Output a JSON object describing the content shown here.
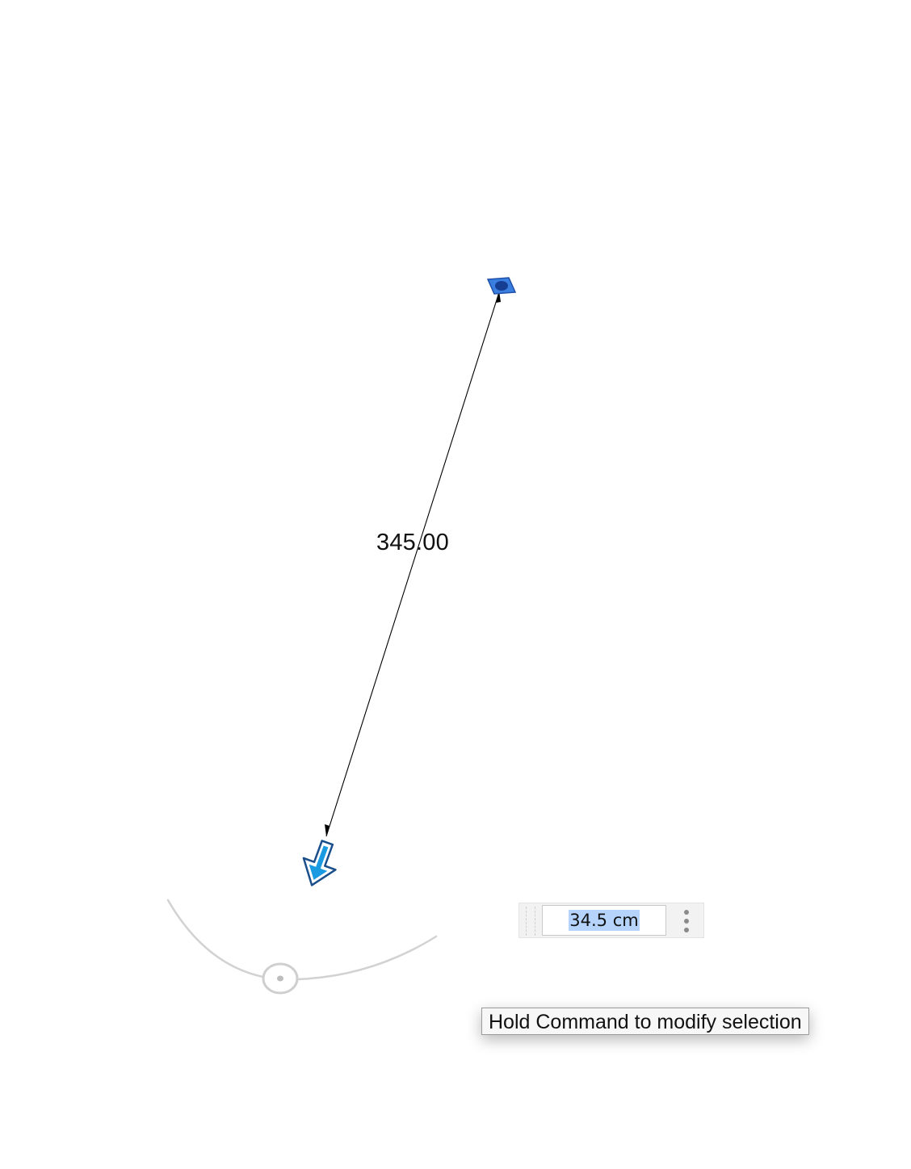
{
  "dimension": {
    "label": "345.00"
  },
  "dimension_input": {
    "value": "34.5 cm",
    "more_icon": "vertical-ellipsis-icon"
  },
  "tooltip": {
    "text": "Hold Command to modify selection"
  },
  "colors": {
    "start_grip": "#2f6fd0",
    "end_arrow": "#1a96dc",
    "selection_highlight": "#b6d4fb",
    "gizmo": "#cfcfcf"
  }
}
